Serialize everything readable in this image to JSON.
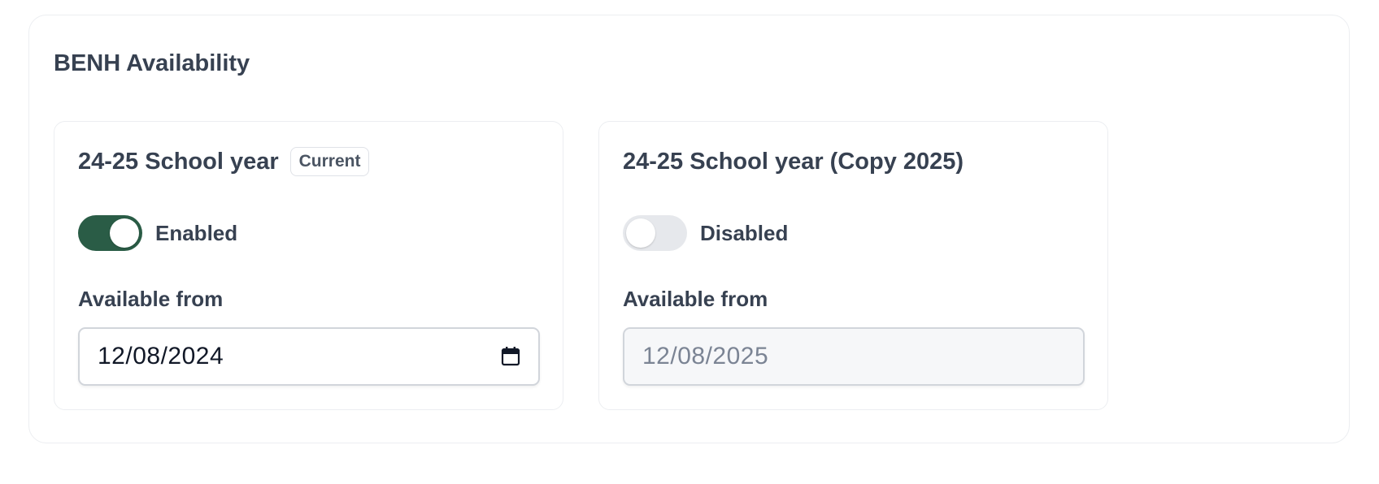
{
  "section": {
    "title": "BENH Availability"
  },
  "years": [
    {
      "title": "24-25 School year",
      "badge": "Current",
      "toggle_state": "on",
      "toggle_label": "Enabled",
      "field_label": "Available from",
      "date_value": "12/08/2024",
      "icon": "calendar-icon"
    },
    {
      "title": "24-25 School year (Copy 2025)",
      "toggle_state": "off",
      "toggle_label": "Disabled",
      "field_label": "Available from",
      "date_value": "12/08/2025"
    }
  ],
  "colors": {
    "toggle_on": "#2a5c46",
    "toggle_off": "#e6e8ec",
    "text": "#374151",
    "border": "#eceef1"
  }
}
